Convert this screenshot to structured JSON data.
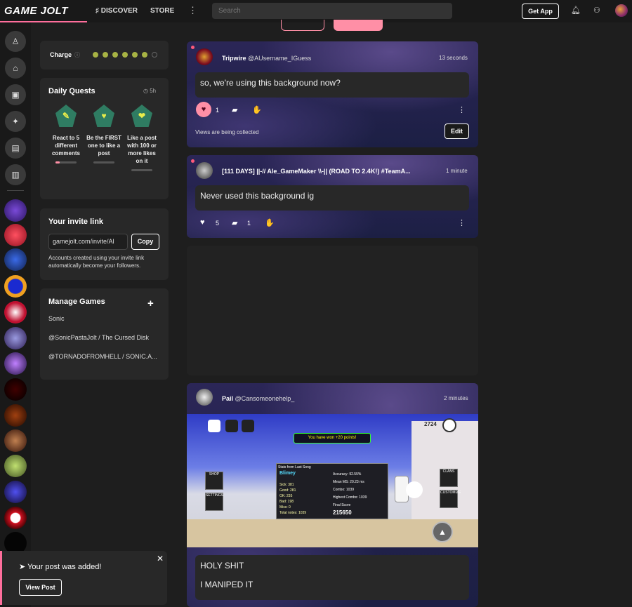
{
  "header": {
    "logo": "GAME JOLT",
    "nav": [
      {
        "label": "DISCOVER"
      },
      {
        "label": "STORE"
      }
    ],
    "more": "⋮",
    "search_placeholder": "Search",
    "get_app": "Get App"
  },
  "charge": {
    "label": "Charge",
    "filled": 6,
    "total": 7
  },
  "quests": {
    "title": "Daily Quests",
    "timer": "5h",
    "items": [
      {
        "label": "React to 5 different comments",
        "progress": 0.2
      },
      {
        "label": "Be the FIRST one to like a post",
        "progress": 0
      },
      {
        "label": "Like a post with 100 or more likes on it",
        "progress": 0
      }
    ]
  },
  "invite": {
    "title": "Your invite link",
    "value": "gamejolt.com/invite/Al",
    "copy": "Copy",
    "note": "Accounts created using your invite link automatically become your followers."
  },
  "games": {
    "title": "Manage Games",
    "add": "+",
    "items": [
      "Sonic",
      "@SonicPastaJolt / The Cursed Disk",
      "@TORNADOFROMHELL / SONIC.A..."
    ]
  },
  "posts": [
    {
      "name": "Tripwire",
      "handle": "@AUsername_IGuess",
      "time": "13 seconds",
      "body": "so, we're using this background now?",
      "likes": "1",
      "comments": "",
      "views": "Views are being collected",
      "edit": "Edit"
    },
    {
      "name": "[111 DAYS] ||-// Ale_GameMaker \\\\-|| (ROAD TO 2.4K!) #TeamA...",
      "time": "1 minute",
      "body": "Never used this background ig",
      "likes": "5",
      "comments": "1"
    },
    {
      "name": "Pail",
      "handle": "@Cansomeonehelp_",
      "time": "2 minutes",
      "body_lines": [
        "HOLY SHIT",
        "I MANIPED IT"
      ],
      "shot": {
        "banner": "You have won +20 points!",
        "panel_title": "Stats from Last Song",
        "player": "Blimey",
        "stats": [
          "Sick: 381",
          "Good: 281",
          "OK: 235",
          "Bad: 198",
          "Miss: 0",
          "Total notes: 1039"
        ],
        "right_stats": [
          "Accuracy: 92.55%",
          "Mean MS: 20.23 ms",
          "Combo: 1039",
          "Highest Combo: 1039"
        ],
        "final_label": "Final Score",
        "final": "215650",
        "shop": "SHOP",
        "settings": "SETTINGS",
        "clans": "CLANS",
        "customize": "CUSTOMIZE",
        "count": "2724"
      }
    }
  ],
  "toast": {
    "message": "Your post was added!",
    "button": "View Post",
    "close": "✕"
  },
  "colors": {
    "accent": "#ff6e9c",
    "like": "#ff8fa6",
    "charge": "#a7b344"
  }
}
